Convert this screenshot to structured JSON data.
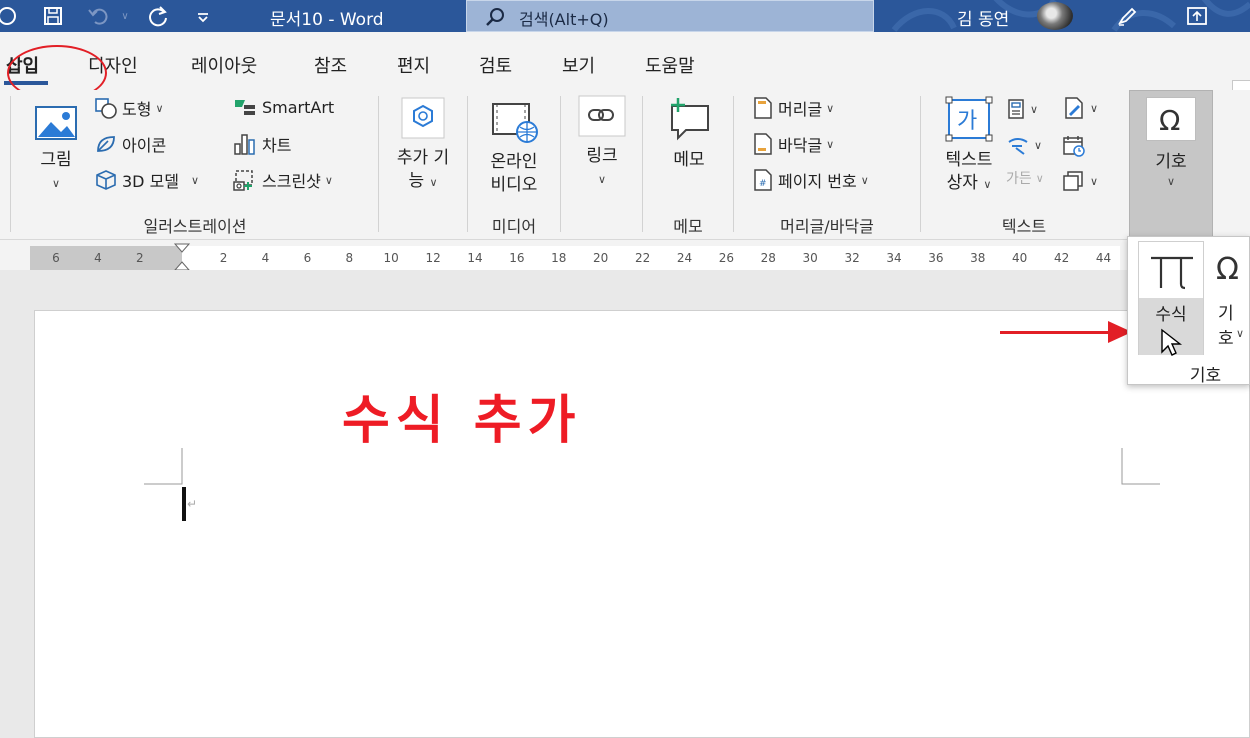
{
  "titlebar": {
    "doc_title": "문서10  -  Word",
    "search_label": "검색(Alt+Q)",
    "user_name": "김 동연"
  },
  "tabs": [
    {
      "label": "삽입",
      "active": true
    },
    {
      "label": "디자인"
    },
    {
      "label": "레이아웃"
    },
    {
      "label": "참조"
    },
    {
      "label": "편지"
    },
    {
      "label": "검토"
    },
    {
      "label": "보기"
    },
    {
      "label": "도움말"
    }
  ],
  "ribbon": {
    "illustrations": {
      "picture": "그림",
      "shapes": "도형",
      "icons": "아이콘",
      "models3d": "3D 모델",
      "smartart": "SmartArt",
      "chart": "차트",
      "screenshot": "스크린샷",
      "group": "일러스트레이션"
    },
    "addins": {
      "line1": "추가 기",
      "line2": "능"
    },
    "media": {
      "line1": "온라인",
      "line2": "비디오",
      "group": "미디어"
    },
    "link": {
      "label": "링크"
    },
    "comment": {
      "label": "메모",
      "group": "메모"
    },
    "header_footer": {
      "header": "머리글",
      "footer": "바닥글",
      "page_number": "페이지 번호",
      "group": "머리글/바닥글"
    },
    "text": {
      "line1": "텍스트",
      "line2": "상자",
      "dropcap": "가든",
      "group": "텍스트"
    },
    "symbols": {
      "label": "기호"
    }
  },
  "ruler": {
    "labels": [
      "6",
      "4",
      "2",
      "2",
      "4",
      "6",
      "8",
      "10",
      "12",
      "14",
      "16",
      "18",
      "20",
      "22",
      "24",
      "26",
      "28",
      "30",
      "32",
      "34",
      "36",
      "38",
      "40",
      "42",
      "44"
    ]
  },
  "document": {
    "caption": "수식 추가",
    "paragraph_mark": "↵"
  },
  "popup": {
    "equation": "수식",
    "symbol": "기호",
    "group": "기호"
  },
  "colors": {
    "titlebar": "#2b579a",
    "accent_red": "#ee1c25"
  }
}
